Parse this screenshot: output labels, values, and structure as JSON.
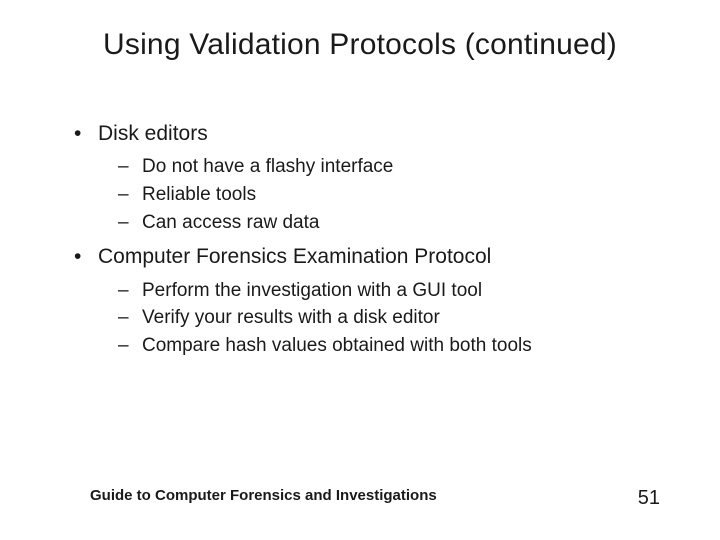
{
  "slide": {
    "title": "Using Validation Protocols (continued)",
    "bullets": [
      {
        "level": 1,
        "text": "Disk editors",
        "children": [
          "Do not have a flashy interface",
          "Reliable tools",
          "Can access raw data"
        ]
      },
      {
        "level": 1,
        "text": "Computer Forensics Examination Protocol",
        "children": [
          "Perform the investigation with a GUI tool",
          "Verify your results with a disk editor",
          "Compare hash values obtained with both tools"
        ]
      }
    ],
    "footer_text": "Guide to Computer Forensics and Investigations",
    "page_number": "51"
  }
}
